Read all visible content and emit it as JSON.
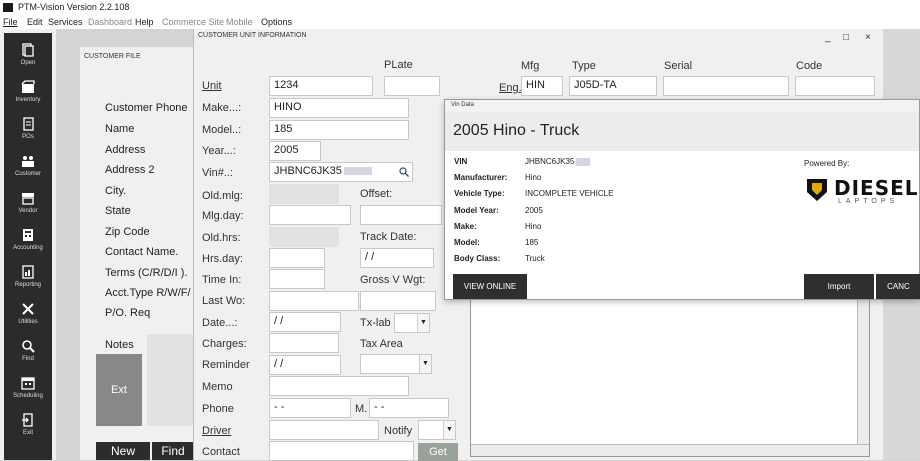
{
  "app": {
    "title": "PTM-Vision Version 2.2.108"
  },
  "menu": [
    "File",
    "Edit",
    "Services",
    "Dashboard",
    "Help",
    "Commerce Site",
    "Mobile",
    "Options"
  ],
  "sidebar": [
    {
      "label": "Open",
      "icon": "document-icon"
    },
    {
      "label": "Inventory",
      "icon": "box-icon"
    },
    {
      "label": "POs",
      "icon": "file-icon"
    },
    {
      "label": "Customer",
      "icon": "people-icon"
    },
    {
      "label": "Vendor",
      "icon": "storefront-icon"
    },
    {
      "label": "Accounting",
      "icon": "calculator-icon"
    },
    {
      "label": "Reporting",
      "icon": "report-icon"
    },
    {
      "label": "Utilities",
      "icon": "wrench-icon"
    },
    {
      "label": "Find",
      "icon": "magnifier-icon"
    },
    {
      "label": "Scheduling",
      "icon": "calendar-icon"
    },
    {
      "label": "Exit",
      "icon": "exit-icon"
    }
  ],
  "customer_file": {
    "header": "CUSTOMER FILE",
    "labels": [
      "Customer Phone",
      "Name",
      "Address",
      "Address 2",
      "City.",
      "State",
      "Zip Code",
      "Contact Name.",
      "Terms (C/R/D/I ).",
      "Acct.Type R/W/F/",
      "P/O. Req"
    ],
    "notes_label": "Notes",
    "exit_button": "Ext",
    "new_button": "New",
    "find_button": "Find"
  },
  "unit_info": {
    "header": "CUSTOMER UNIT INFORMATION",
    "controls": [
      "_",
      "□",
      "×"
    ],
    "labels": {
      "unit": "Unit",
      "make": "Make...:",
      "model": "Model..:",
      "year": "Year...:",
      "vin": "Vin#..:",
      "old_mlg": "Old.mlg:",
      "mlg_day": "Mlg.day:",
      "old_hrs": "Old.hrs:",
      "hrs_day": "Hrs.day:",
      "time_in": "Time In:",
      "last_wo": "Last Wo:",
      "date": "Date...:",
      "charges": "Charges:",
      "reminder": "Reminder",
      "memo": "Memo",
      "phone": "Phone",
      "driver": "Driver",
      "contact": "Contact",
      "plate": "PLate",
      "offset": "Offset:",
      "track_date": "Track Date:",
      "gross_v_wgt": "Gross V Wgt:",
      "tx_lab": "Tx-lab",
      "tax_area": "Tax Area",
      "notify": "Notify",
      "m": "M."
    },
    "values": {
      "unit": "1234",
      "make": "HINO",
      "model": "185",
      "year": "2005",
      "vin": "JHBNC6JK35",
      "date": "/ /",
      "reminder": "/ /",
      "track_date": "/ /",
      "phone": "-   -",
      "phone2": "-   -"
    },
    "engine": {
      "label": "Eng. :",
      "headers": {
        "mfg": "Mfg",
        "type": "Type",
        "serial": "Serial",
        "code": "Code"
      },
      "mfg": "HIN",
      "type": "J05D-TA"
    },
    "get_button": "Get"
  },
  "vin_popup": {
    "header": "Vin Data",
    "title": "2005 Hino - Truck",
    "powered_by": "Powered By:",
    "brand": "DIESEL",
    "brand_sub": "LAPTOPS",
    "fields": [
      {
        "key": "VIN",
        "value": "JHBNC6JK35"
      },
      {
        "key": "Manufacturer:",
        "value": "Hino"
      },
      {
        "key": "Vehicle Type:",
        "value": "INCOMPLETE VEHICLE"
      },
      {
        "key": "Model Year:",
        "value": "2005"
      },
      {
        "key": "Make:",
        "value": "Hino"
      },
      {
        "key": "Model:",
        "value": "185"
      },
      {
        "key": "Body Class:",
        "value": "Truck"
      }
    ],
    "view_online": "VIEW ONLINE",
    "import": "Import",
    "cancel": "CANC"
  }
}
